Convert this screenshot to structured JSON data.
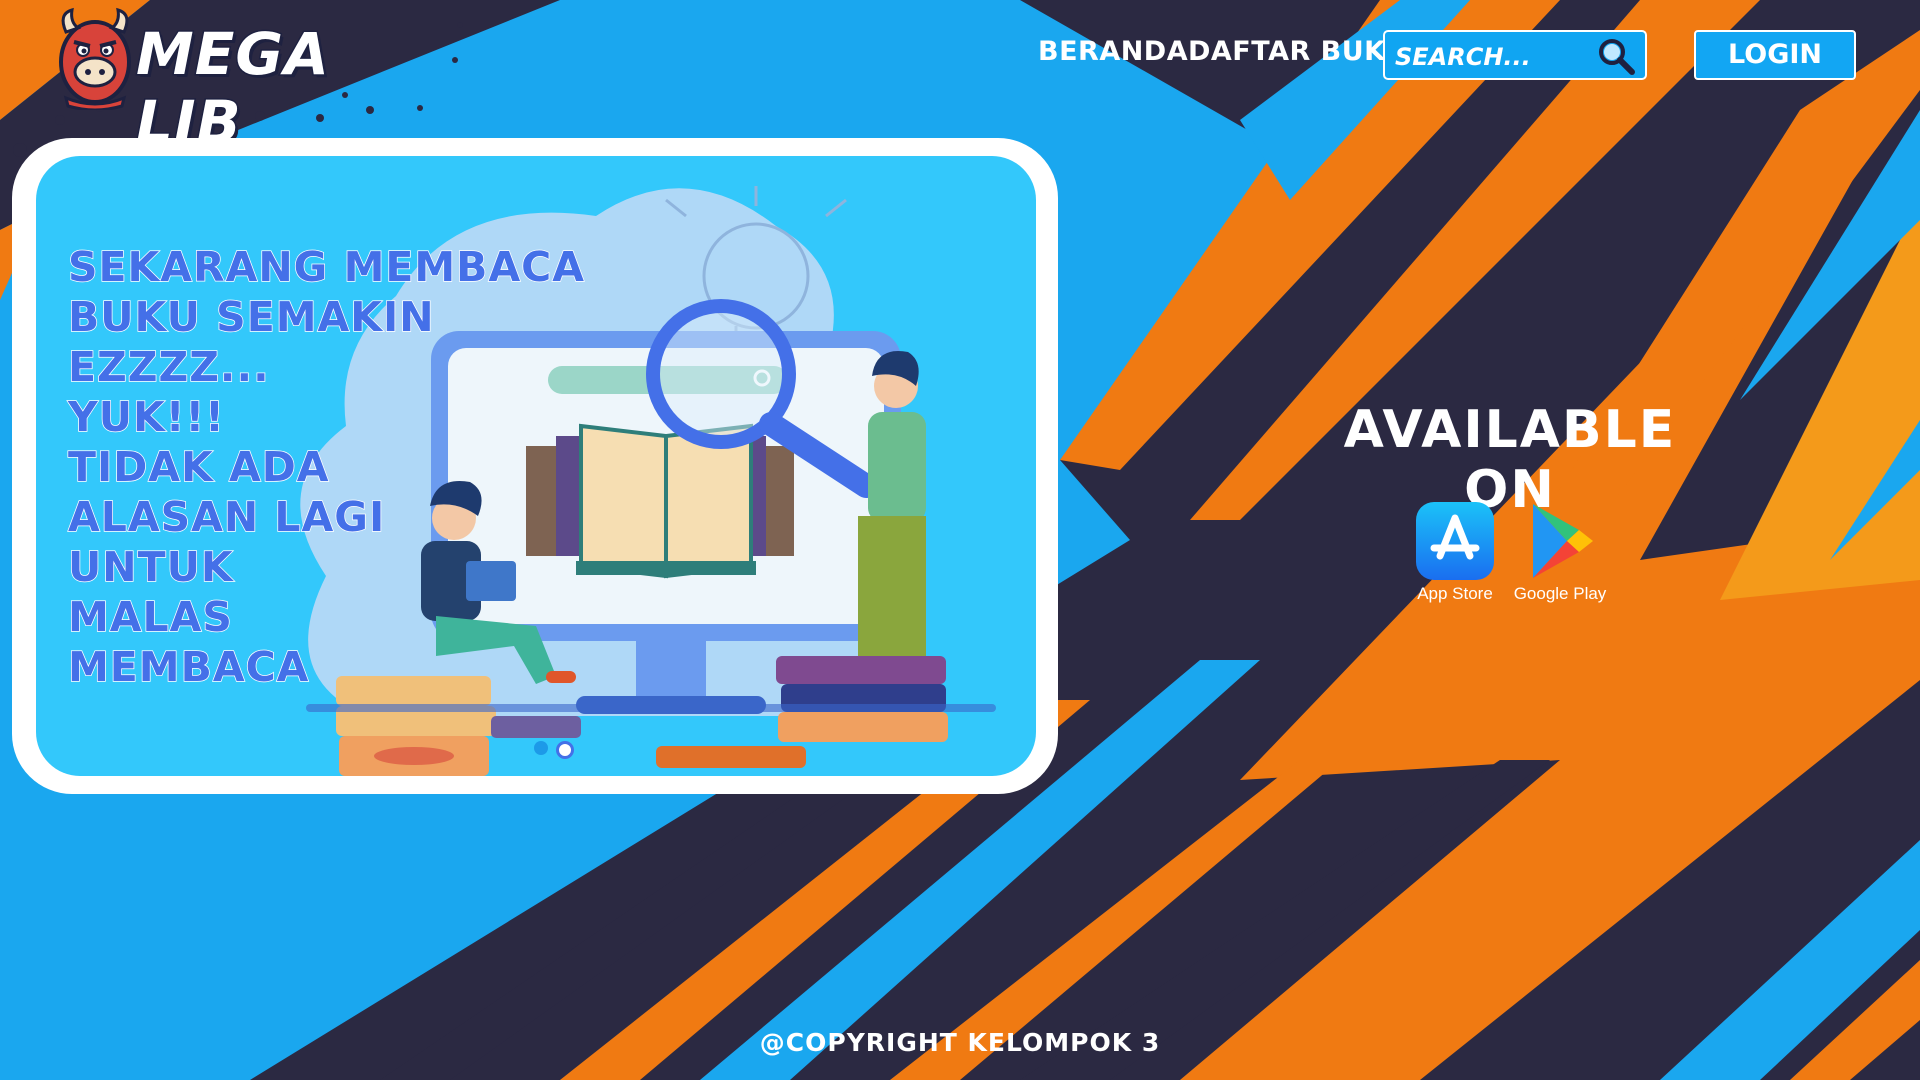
{
  "brand": {
    "name": "MEGA LIB",
    "logo_icon": "bull-mascot-icon"
  },
  "nav": {
    "items": [
      {
        "label": "BERANDA"
      },
      {
        "label": "DAFTAR BUKU"
      }
    ]
  },
  "search": {
    "placeholder": "SEARCH...",
    "value": "",
    "icon": "search-icon"
  },
  "auth": {
    "login_label": "LOGIN"
  },
  "hero": {
    "headline": "SEKARANG MEMBACA\nBUKU SEMAKIN\nEZZZZ...\nYUK!!!\nTIDAK ADA\nALASAN LAGI\nUNTUK\nMALAS\nMEMBACA",
    "illustration": "reading-online-illustration",
    "carousel": {
      "total_slides": 2,
      "active_slide": 1
    }
  },
  "stores": {
    "title": "AVAILABLE ON",
    "badges": [
      {
        "label": "App Store",
        "icon": "app-store-icon"
      },
      {
        "label": "Google Play",
        "icon": "google-play-icon"
      }
    ]
  },
  "footer": {
    "copyright": "@COPYRIGHT KELOMPOK 3"
  },
  "colors": {
    "background_blue": "#1aa7ef",
    "stripe_navy": "#2b2942",
    "stripe_orange": "#f07a12",
    "hero_panel": "#33c8fb",
    "hero_text": "#4470e8",
    "white": "#ffffff"
  }
}
